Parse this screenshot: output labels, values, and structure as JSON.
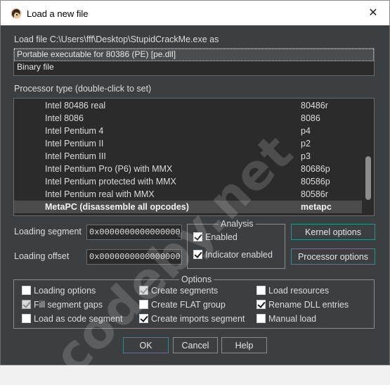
{
  "window": {
    "title": "Load a new file",
    "close_glyph": "✕"
  },
  "load_file_label": "Load file C:\\Users\\fff\\Desktop\\StupidCrackMe.exe as",
  "file_types": [
    {
      "label": "Portable executable for 80386 (PE) [pe.dll]",
      "selected": true
    },
    {
      "label": "Binary file",
      "selected": false
    }
  ],
  "processor_label": "Processor type (double-click to set)",
  "processors": [
    {
      "name": "Intel 80486 real",
      "code": "80486r",
      "selected": false
    },
    {
      "name": "Intel 8086",
      "code": "8086",
      "selected": false
    },
    {
      "name": "Intel Pentium 4",
      "code": "p4",
      "selected": false
    },
    {
      "name": "Intel Pentium II",
      "code": "p2",
      "selected": false
    },
    {
      "name": "Intel Pentium III",
      "code": "p3",
      "selected": false
    },
    {
      "name": "Intel Pentium Pro (P6) with MMX",
      "code": "80686p",
      "selected": false
    },
    {
      "name": "Intel Pentium protected with MMX",
      "code": "80586p",
      "selected": false
    },
    {
      "name": "Intel Pentium real with MMX",
      "code": "80586r",
      "selected": false
    },
    {
      "name": "MetaPC (disassemble all opcodes)",
      "code": "metapc",
      "selected": true
    }
  ],
  "loading_segment": {
    "label": "Loading segment",
    "value": "0x0000000000000000"
  },
  "loading_offset": {
    "label": "Loading offset",
    "value": "0x0000000000000000"
  },
  "analysis": {
    "title": "Analysis",
    "enabled": {
      "label": "Enabled",
      "checked": true
    },
    "indicator": {
      "label": "Indicator enabled",
      "checked": true
    }
  },
  "buttons": {
    "kernel": "Kernel options",
    "processor": "Processor options",
    "ok": "OK",
    "cancel": "Cancel",
    "help": "Help"
  },
  "options": {
    "title": "Options",
    "loading_options": {
      "label": "Loading options",
      "checked": false,
      "disabled": false
    },
    "fill_segment_gaps": {
      "label": "Fill segment gaps",
      "checked": true,
      "disabled": true
    },
    "load_as_code_segment": {
      "label": "Load as code segment",
      "checked": false,
      "disabled": false
    },
    "create_segments": {
      "label": "Create segments",
      "checked": true,
      "disabled": true
    },
    "create_flat_group": {
      "label": "Create FLAT group",
      "checked": false,
      "disabled": false
    },
    "create_imports_segment": {
      "label": "Create imports segment",
      "checked": true,
      "disabled": false
    },
    "load_resources": {
      "label": "Load resources",
      "checked": false,
      "disabled": false
    },
    "rename_dll_entries": {
      "label": "Rename DLL entries",
      "checked": true,
      "disabled": false
    },
    "manual_load": {
      "label": "Manual load",
      "checked": false,
      "disabled": false
    }
  },
  "watermark": "codeby.net",
  "colors": {
    "background": "#3c3f41",
    "list_background": "#2b2b2b",
    "accent_border": "#2f8e8e"
  }
}
